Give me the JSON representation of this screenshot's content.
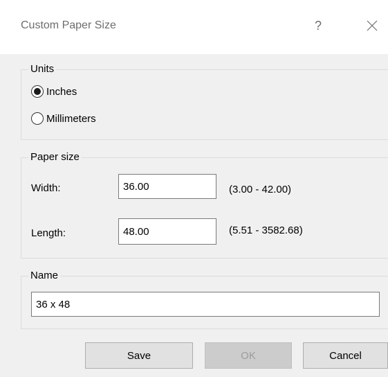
{
  "dialog": {
    "title": "Custom Paper Size",
    "help_glyph": "?",
    "close_icon": "close-icon"
  },
  "units": {
    "legend": "Units",
    "options": [
      {
        "label": "Inches",
        "selected": true
      },
      {
        "label": "Millimeters",
        "selected": false
      }
    ]
  },
  "paper_size": {
    "legend": "Paper size",
    "width": {
      "label": "Width:",
      "value": "36.00",
      "range": "(3.00 - 42.00)"
    },
    "length": {
      "label": "Length:",
      "value": "48.00",
      "range": "(5.51 - 3582.68)"
    }
  },
  "name": {
    "legend": "Name",
    "value": "36 x 48"
  },
  "buttons": {
    "save": "Save",
    "ok": "OK",
    "cancel": "Cancel"
  }
}
